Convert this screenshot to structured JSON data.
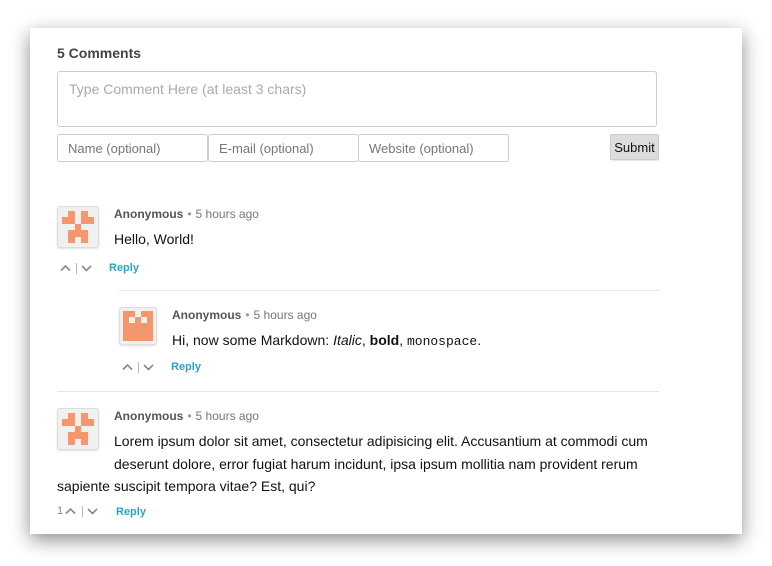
{
  "header": {
    "count_title": "5 Comments"
  },
  "form": {
    "comment_placeholder": "Type Comment Here (at least 3 chars)",
    "name_placeholder": "Name (optional)",
    "email_placeholder": "E-mail (optional)",
    "website_placeholder": "Website (optional)",
    "submit_label": "Submit"
  },
  "avatar_colors": {
    "background": "#f0f0f0",
    "foreground": "#f4976c"
  },
  "comments": [
    {
      "author": "Anonymous",
      "separator": "•",
      "time": "5 hours ago",
      "text": "Hello, World!",
      "score": "",
      "reply_label": "Reply",
      "avatar_pattern": [
        "01010",
        "11011",
        "00100",
        "01110",
        "01010"
      ]
    },
    {
      "author": "Anonymous",
      "separator": "•",
      "time": "5 hours ago",
      "text_parts": {
        "prefix": "Hi, now some Markdown: ",
        "italic": "Italic",
        "comma1": ", ",
        "bold": "bold",
        "comma2": ", ",
        "mono": "monospace",
        "suffix": "."
      },
      "score": "",
      "reply_label": "Reply",
      "avatar_pattern": [
        "11011",
        "10101",
        "11111",
        "11111",
        "11111"
      ]
    },
    {
      "author": "Anonymous",
      "separator": "•",
      "time": "5 hours ago",
      "text_line1": "Lorem ipsum dolor sit amet, consectetur adipisicing elit. Accusantium at commodi cum",
      "text_line2": "deserunt dolore, error fugiat harum incidunt, ipsa ipsum mollitia nam provident rerum",
      "text_line3": "sapiente suscipit tempora vitae? Est, qui?",
      "score": "1",
      "reply_label": "Reply",
      "avatar_pattern": [
        "01010",
        "11011",
        "00100",
        "01110",
        "01010"
      ]
    }
  ]
}
